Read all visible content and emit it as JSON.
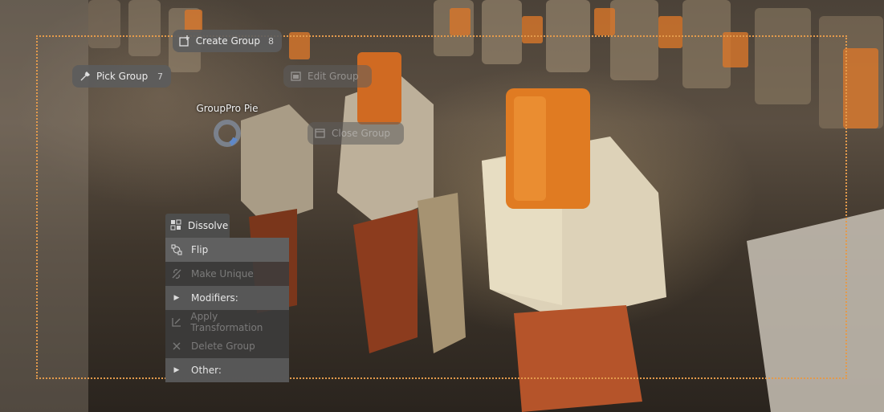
{
  "pie_menu": {
    "title": "GroupPro Pie",
    "buttons": {
      "create_group": {
        "label": "Create Group",
        "number": "8",
        "icon": "create-group-icon"
      },
      "pick_group": {
        "label": "Pick Group",
        "number": "7",
        "icon": "eyedropper-icon"
      },
      "edit_group": {
        "label": "Edit Group",
        "icon": "edit-group-icon"
      },
      "close_group": {
        "label": "Close Group",
        "icon": "close-group-icon"
      }
    }
  },
  "context_menu": {
    "header": {
      "label": "Dissolve",
      "icon": "dissolve-icon"
    },
    "items": [
      {
        "label": "Flip",
        "icon": "flip-icon",
        "state": "highlighted"
      },
      {
        "label": "Make Unique",
        "icon": "make-unique-icon",
        "state": "disabled"
      },
      {
        "label": "Modifiers:",
        "icon": "triangle-right-icon",
        "state": "submenu"
      },
      {
        "label": "Apply Transformation",
        "icon": "apply-transform-icon",
        "state": "disabled"
      },
      {
        "label": "Delete Group",
        "icon": "delete-icon",
        "state": "disabled"
      },
      {
        "label": "Other:",
        "icon": "triangle-right-icon",
        "state": "submenu"
      }
    ]
  },
  "colors": {
    "selection_frame": "#e39a4c",
    "accent_orange": "#d9772a"
  }
}
